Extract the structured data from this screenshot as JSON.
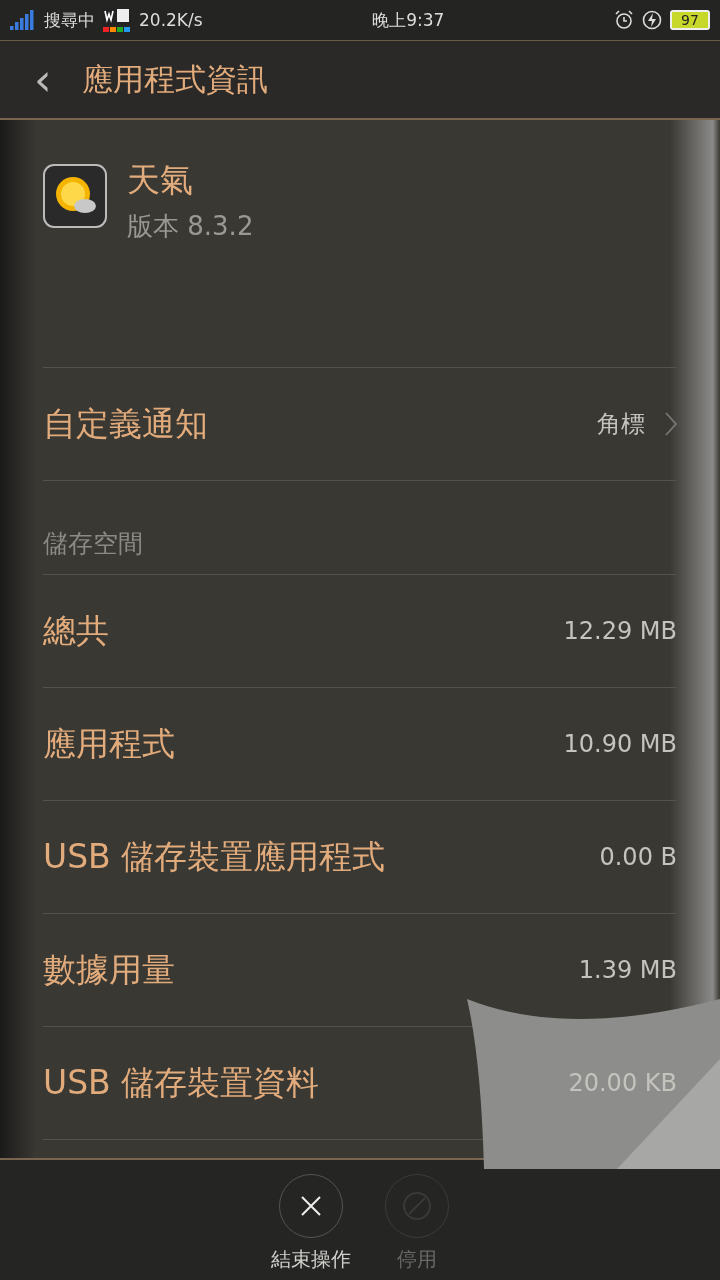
{
  "status_bar": {
    "carrier": "搜尋中",
    "speed": "20.2K/s",
    "time": "晚上9:37",
    "battery": "97"
  },
  "header": {
    "back": "‹",
    "title": "應用程式資訊"
  },
  "app": {
    "name": "天氣",
    "version": "版本 8.3.2"
  },
  "notification_row": {
    "label": "自定義通知",
    "value": "角標"
  },
  "storage": {
    "heading": "儲存空間",
    "rows": [
      {
        "label": "總共",
        "value": "12.29 MB"
      },
      {
        "label": "應用程式",
        "value": "10.90 MB"
      },
      {
        "label": "USB 儲存裝置應用程式",
        "value": "0.00 B"
      },
      {
        "label": "數據用量",
        "value": "1.39 MB"
      },
      {
        "label": "USB 儲存裝置資料",
        "value": "20.00 KB"
      }
    ]
  },
  "actions": [
    {
      "kind": "close",
      "label": "結束操作",
      "disabled": false
    },
    {
      "kind": "block",
      "label": "停用",
      "disabled": true
    }
  ]
}
